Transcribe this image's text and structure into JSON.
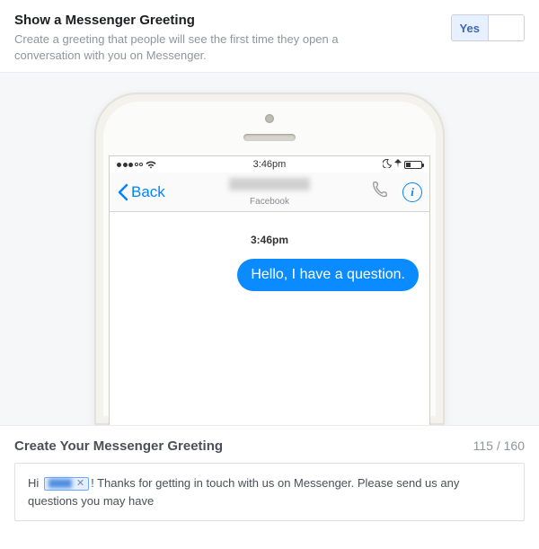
{
  "header": {
    "title": "Show a Messenger Greeting",
    "description": "Create a greeting that people will see the first time they open a conversation with you on Messenger.",
    "toggle": {
      "yes_label": "Yes",
      "no_label": "",
      "value": "yes"
    }
  },
  "phone_preview": {
    "status_bar": {
      "time": "3:46pm"
    },
    "nav": {
      "back_label": "Back",
      "contact_name": "",
      "subtitle": "Facebook"
    },
    "chat": {
      "timestamp": "3:46pm",
      "outgoing_message": "Hello, I have a question."
    }
  },
  "greeting_editor": {
    "title": "Create Your Messenger Greeting",
    "char_count": "115 / 160",
    "text_before_token": "Hi ",
    "token_label": "",
    "text_after_token": "! Thanks for getting in touch with us on Messenger. Please send us any questions you may have"
  }
}
